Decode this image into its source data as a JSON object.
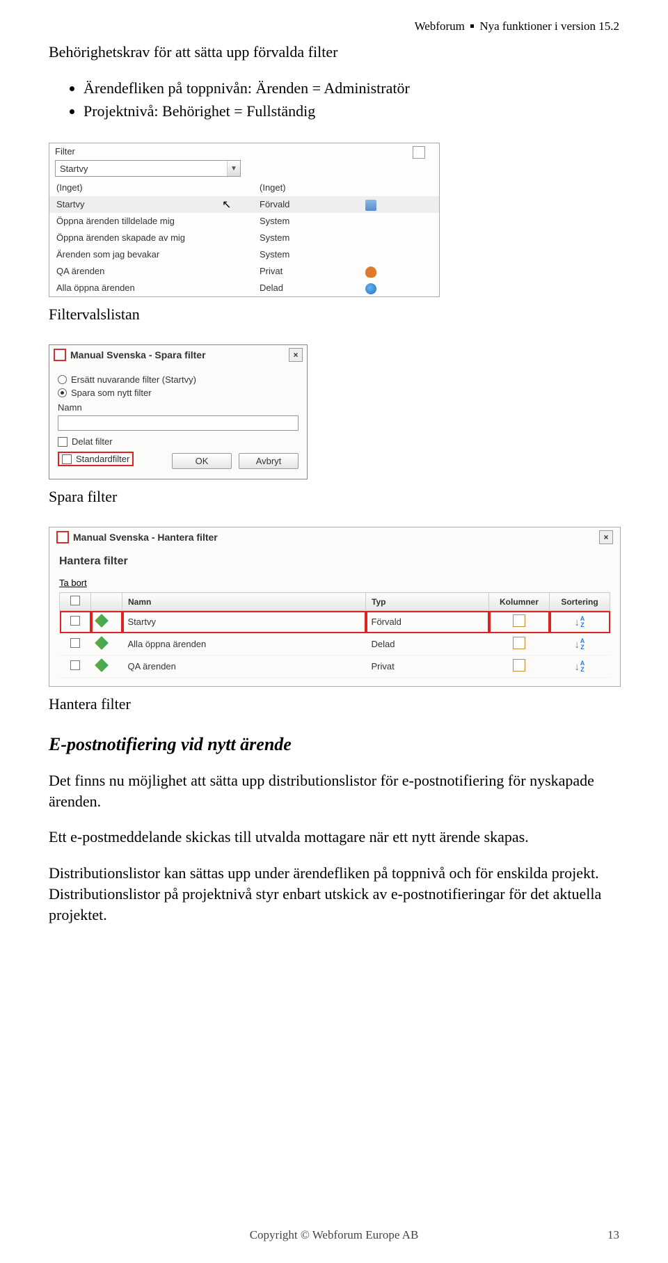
{
  "header": {
    "left": "Webforum",
    "right": "Nya funktioner i version 15.2"
  },
  "intro": {
    "title": "Behörighetskrav för att sätta upp förvalda filter",
    "bullet1": "Ärendefliken på toppnivån: Ärenden = Administratör",
    "bullet2": "Projektnivå: Behörighet = Fullständig"
  },
  "filterlist": {
    "top_label": "Filter",
    "input_value": "Startvy",
    "rows": [
      {
        "name": "(Inget)",
        "type": "(Inget)",
        "icon": ""
      },
      {
        "name": "Startvy",
        "type": "Förvald",
        "icon": "blue-grid",
        "hover": true
      },
      {
        "name": "Öppna ärenden tilldelade mig",
        "type": "System",
        "icon": ""
      },
      {
        "name": "Öppna ärenden skapade av mig",
        "type": "System",
        "icon": ""
      },
      {
        "name": "Ärenden som jag bevakar",
        "type": "System",
        "icon": ""
      },
      {
        "name": "QA ärenden",
        "type": "Privat",
        "icon": "orange-person"
      },
      {
        "name": "Alla öppna ärenden",
        "type": "Delad",
        "icon": "globe"
      }
    ],
    "caption": "Filtervalslistan"
  },
  "save_dialog": {
    "title": "Manual Svenska - Spara filter",
    "radio1": "Ersätt nuvarande filter (Startvy)",
    "radio2": "Spara som nytt filter",
    "name_label": "Namn",
    "chk_shared": "Delat filter",
    "chk_std": "Standardfilter",
    "btn_ok": "OK",
    "btn_cancel": "Avbryt",
    "caption": "Spara filter"
  },
  "manage_dialog": {
    "title": "Manual Svenska - Hantera filter",
    "section": "Hantera filter",
    "remove_link": "Ta bort",
    "th_name": "Namn",
    "th_type": "Typ",
    "th_cols": "Kolumner",
    "th_sort": "Sortering",
    "rows": [
      {
        "name": "Startvy",
        "type": "Förvald",
        "hl": true
      },
      {
        "name": "Alla öppna ärenden",
        "type": "Delad"
      },
      {
        "name": "QA ärenden",
        "type": "Privat"
      }
    ],
    "caption": "Hantera filter"
  },
  "body_text": {
    "subheading": "E-postnotifiering vid nytt ärende",
    "p1": "Det finns nu möjlighet att sätta upp distributionslistor för e-postnotifiering för nyskapade ärenden.",
    "p2": "Ett e-postmeddelande skickas till utvalda mottagare när ett nytt ärende skapas.",
    "p3": "Distributionslistor kan sättas upp under ärendefliken på toppnivå och för enskilda projekt. Distributionslistor på projektnivå styr enbart utskick av e-postnotifieringar för det aktuella projektet."
  },
  "footer": {
    "copyright": "Copyright © Webforum Europe AB",
    "page": "13"
  }
}
